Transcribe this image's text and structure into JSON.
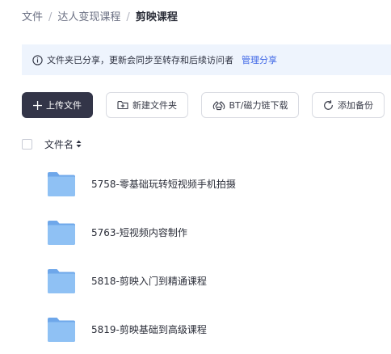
{
  "breadcrumb": {
    "items": [
      "文件",
      "达人变现课程",
      "剪映课程"
    ],
    "separator": "/"
  },
  "notice": {
    "icon": "info-icon",
    "text": "文件夹已分享，更新会同步至转存和后续访问者",
    "link": "管理分享"
  },
  "toolbar": {
    "upload_label": "上传文件",
    "new_folder_label": "新建文件夹",
    "bt_label": "BT/磁力链下载",
    "backup_label": "添加备份"
  },
  "list": {
    "header_name": "文件名",
    "files": [
      {
        "name": "5758-零基础玩转短视频手机拍摄",
        "type": "folder"
      },
      {
        "name": "5763-短视频内容制作",
        "type": "folder"
      },
      {
        "name": "5818-剪映入门到精通课程",
        "type": "folder"
      },
      {
        "name": "5819-剪映基础到高级课程",
        "type": "folder"
      }
    ]
  },
  "colors": {
    "primary_button": "#333548",
    "notice_bg": "#eef4fd",
    "link": "#3e66e6",
    "folder": "#7cb3f0"
  }
}
